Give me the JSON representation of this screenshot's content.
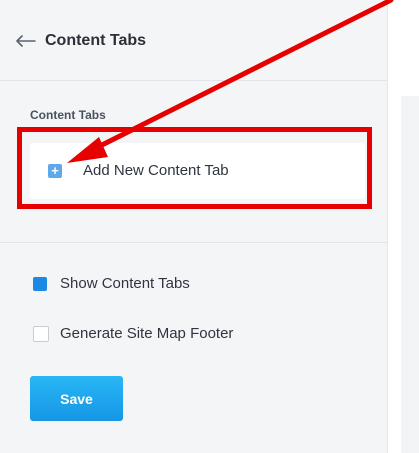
{
  "header": {
    "back_icon": "arrow-left-icon",
    "title": "Content Tabs"
  },
  "content_tabs_section": {
    "label": "Content Tabs",
    "add_tab": {
      "icon": "plus-icon",
      "icon_glyph": "+",
      "label": "Add New Content Tab"
    }
  },
  "options": [
    {
      "label": "Show Content Tabs",
      "checked": true
    },
    {
      "label": "Generate Site Map Footer",
      "checked": false
    }
  ],
  "actions": {
    "save_label": "Save"
  },
  "annotation": {
    "color": "#e60000",
    "arrow_icon": "arrow-pointer-icon"
  },
  "colors": {
    "accent": "#1e88e5",
    "button": "#1597e5",
    "panel_background": "#f4f5f6"
  }
}
